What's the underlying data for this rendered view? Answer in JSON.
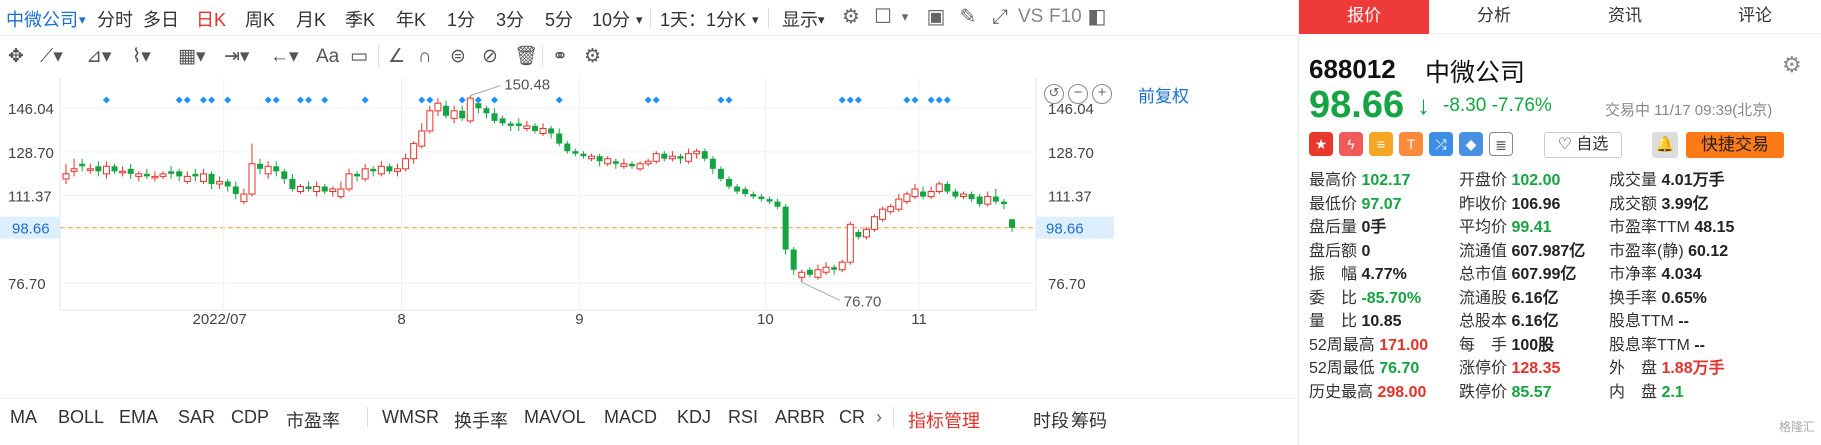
{
  "toolbar": {
    "symbol": "中微公司",
    "periods": [
      "分时",
      "多日",
      "日K",
      "周K",
      "月K",
      "季K",
      "年K",
      "1分",
      "3分",
      "5分",
      "10分"
    ],
    "active_period": "日K",
    "interval_select": "1天：1分K",
    "display_label": "显示",
    "vs_label": "VS",
    "f10_label": "F10"
  },
  "drawing_tools": [
    "crosshair",
    "line",
    "channel",
    "wave",
    "fibonacci",
    "measure",
    "arrow",
    "text",
    "note",
    "ruler",
    "magnet",
    "lock",
    "hide",
    "delete",
    "compare",
    "settings"
  ],
  "chart": {
    "fq_label": "前复权",
    "ctrl_minus": "−",
    "ctrl_plus": "+"
  },
  "chart_data": {
    "type": "candlestick",
    "title": "",
    "y_ticks": [
      "146.04",
      "128.70",
      "111.37",
      "98.66",
      "76.70"
    ],
    "x_ticks": [
      "2022/07",
      "8",
      "9",
      "10",
      "11"
    ],
    "ylim": [
      70,
      158
    ],
    "current_price": 98.66,
    "max_label": "150.48",
    "min_label": "76.70",
    "grid": true,
    "candles": [
      [
        1,
        118,
        120,
        116,
        124
      ],
      [
        1,
        121,
        122,
        119,
        126
      ],
      [
        0,
        124,
        123,
        121,
        126
      ],
      [
        1,
        122,
        122,
        120,
        124
      ],
      [
        0,
        121,
        123,
        119,
        125
      ],
      [
        1,
        120,
        123,
        118,
        125
      ],
      [
        0,
        123,
        121,
        120,
        124
      ],
      [
        1,
        121,
        121,
        119,
        123
      ],
      [
        0,
        122,
        120,
        118,
        124
      ],
      [
        1,
        119,
        120,
        117,
        121
      ],
      [
        0,
        120,
        119,
        118,
        122
      ],
      [
        1,
        119,
        119,
        117,
        121
      ],
      [
        1,
        119,
        120,
        118,
        121
      ],
      [
        0,
        120,
        121,
        118,
        123
      ],
      [
        0,
        121,
        119,
        117,
        122
      ],
      [
        1,
        117,
        119,
        116,
        121
      ],
      [
        0,
        119,
        120,
        117,
        122
      ],
      [
        1,
        117,
        120,
        116,
        122
      ],
      [
        0,
        120,
        116,
        114,
        121
      ],
      [
        1,
        116,
        117,
        114,
        119
      ],
      [
        0,
        117,
        115,
        113,
        118
      ],
      [
        0,
        115,
        112,
        110,
        117
      ],
      [
        1,
        109,
        112,
        108,
        114
      ],
      [
        1,
        112,
        124,
        111,
        132
      ],
      [
        0,
        124,
        122,
        120,
        126
      ],
      [
        1,
        120,
        123,
        118,
        125
      ],
      [
        0,
        123,
        121,
        119,
        125
      ],
      [
        0,
        121,
        118,
        116,
        122
      ],
      [
        0,
        118,
        114,
        113,
        120
      ],
      [
        1,
        113,
        115,
        112,
        116
      ],
      [
        0,
        115,
        114,
        113,
        117
      ],
      [
        1,
        113,
        115,
        111,
        117
      ],
      [
        0,
        115,
        113,
        112,
        116
      ],
      [
        1,
        113,
        114,
        111,
        115
      ],
      [
        1,
        111,
        114,
        110,
        117
      ],
      [
        1,
        114,
        120,
        113,
        122
      ],
      [
        0,
        120,
        119,
        117,
        121
      ],
      [
        1,
        118,
        122,
        117,
        124
      ],
      [
        0,
        122,
        121,
        119,
        123
      ],
      [
        1,
        120,
        123,
        119,
        125
      ],
      [
        0,
        123,
        121,
        120,
        124
      ],
      [
        1,
        121,
        122,
        119,
        124
      ],
      [
        1,
        122,
        126,
        121,
        128
      ],
      [
        1,
        126,
        132,
        124,
        133
      ],
      [
        1,
        131,
        137,
        130,
        140
      ],
      [
        1,
        137,
        145,
        136,
        147
      ],
      [
        1,
        145,
        148,
        143,
        150
      ],
      [
        0,
        147,
        143,
        142,
        149
      ],
      [
        1,
        142,
        145,
        140,
        147
      ],
      [
        0,
        145,
        142,
        141,
        147
      ],
      [
        1,
        141,
        150,
        140,
        151
      ],
      [
        0,
        148,
        146,
        144,
        149
      ],
      [
        0,
        146,
        144,
        142,
        147
      ],
      [
        0,
        144,
        141,
        140,
        146
      ],
      [
        0,
        142,
        140,
        139,
        143
      ],
      [
        0,
        140,
        139,
        137,
        141
      ],
      [
        0,
        140,
        139,
        137,
        142
      ],
      [
        1,
        138,
        139,
        137,
        141
      ],
      [
        0,
        139,
        137,
        136,
        140
      ],
      [
        1,
        136,
        138,
        135,
        140
      ],
      [
        0,
        138,
        136,
        134,
        139
      ],
      [
        0,
        136,
        132,
        131,
        138
      ],
      [
        0,
        132,
        129,
        128,
        133
      ],
      [
        0,
        129,
        128,
        127,
        130
      ],
      [
        0,
        128,
        127,
        126,
        129
      ],
      [
        1,
        126,
        127,
        125,
        128
      ],
      [
        0,
        127,
        125,
        123,
        128
      ],
      [
        1,
        124,
        126,
        123,
        127
      ],
      [
        0,
        125,
        124,
        122,
        126
      ],
      [
        1,
        123,
        124,
        122,
        126
      ],
      [
        0,
        124,
        123,
        122,
        125
      ],
      [
        1,
        122,
        124,
        121,
        125
      ],
      [
        1,
        124,
        125,
        123,
        126
      ],
      [
        1,
        125,
        128,
        124,
        129
      ],
      [
        0,
        128,
        126,
        125,
        129
      ],
      [
        1,
        126,
        127,
        125,
        129
      ],
      [
        0,
        127,
        126,
        124,
        128
      ],
      [
        1,
        125,
        128,
        124,
        130
      ],
      [
        1,
        128,
        129,
        126,
        130
      ],
      [
        0,
        129,
        126,
        125,
        130
      ],
      [
        0,
        126,
        122,
        120,
        127
      ],
      [
        0,
        122,
        118,
        117,
        123
      ],
      [
        0,
        118,
        115,
        114,
        119
      ],
      [
        0,
        115,
        113,
        112,
        116
      ],
      [
        0,
        114,
        112,
        111,
        115
      ],
      [
        0,
        112,
        111,
        110,
        113
      ],
      [
        0,
        111,
        110,
        109,
        112
      ],
      [
        0,
        110,
        109,
        108,
        111
      ],
      [
        0,
        109,
        107,
        106,
        110
      ],
      [
        0,
        107,
        90,
        88,
        108
      ],
      [
        0,
        90,
        82,
        80,
        91
      ],
      [
        1,
        79,
        81,
        77,
        82
      ],
      [
        0,
        82,
        80,
        79,
        83
      ],
      [
        1,
        79,
        82,
        78,
        84
      ],
      [
        1,
        81,
        83,
        80,
        85
      ],
      [
        0,
        83,
        82,
        80,
        84
      ],
      [
        1,
        82,
        85,
        81,
        86
      ],
      [
        1,
        85,
        100,
        84,
        101
      ],
      [
        0,
        97,
        95,
        94,
        98
      ],
      [
        1,
        95,
        98,
        94,
        99
      ],
      [
        1,
        98,
        103,
        97,
        104
      ],
      [
        1,
        102,
        106,
        101,
        107
      ],
      [
        1,
        105,
        107,
        104,
        108
      ],
      [
        1,
        106,
        110,
        105,
        112
      ],
      [
        1,
        109,
        112,
        108,
        113
      ],
      [
        1,
        111,
        114,
        110,
        116
      ],
      [
        0,
        113,
        111,
        110,
        115
      ],
      [
        1,
        111,
        113,
        110,
        115
      ],
      [
        1,
        113,
        116,
        112,
        117
      ],
      [
        0,
        116,
        113,
        112,
        117
      ],
      [
        0,
        113,
        111,
        110,
        114
      ],
      [
        1,
        111,
        112,
        110,
        113
      ],
      [
        0,
        112,
        110,
        109,
        113
      ],
      [
        0,
        111,
        108,
        107,
        112
      ],
      [
        1,
        108,
        111,
        107,
        113
      ],
      [
        0,
        111,
        109,
        108,
        114
      ],
      [
        0,
        109,
        108,
        106,
        110
      ],
      [
        0,
        102,
        98.66,
        97,
        102.17
      ]
    ],
    "markers": [
      5,
      14,
      15,
      17,
      18,
      20,
      25,
      26,
      29,
      30,
      32,
      37,
      44,
      45,
      49,
      51,
      53,
      61,
      72,
      73,
      81,
      82,
      96,
      97,
      98,
      104,
      105,
      107,
      108,
      109
    ]
  },
  "indicators": {
    "tabs": [
      "MA",
      "BOLL",
      "EMA",
      "SAR",
      "CDP",
      "市盈率",
      "WMSR",
      "换手率",
      "MAVOL",
      "MACD",
      "KDJ",
      "RSI",
      "ARBR",
      "CR"
    ],
    "more": "›",
    "manage": "指标管理",
    "right_tabs": [
      "时段",
      "筹码"
    ]
  },
  "panel": {
    "tabs": [
      "报价",
      "分析",
      "资讯",
      "评论"
    ],
    "active_tab": "报价",
    "code": "688012",
    "name": "中微公司",
    "price": "98.66",
    "change": "-8.30 -7.76%",
    "status": "交易中 11/17 09:39(北京)",
    "self_select": "自选",
    "quick_trade": "快捷交易",
    "quote_rows": [
      [
        {
          "label": "最高价",
          "value": "102.17",
          "tone": "dn"
        },
        {
          "label": "开盘价",
          "value": "102.00",
          "tone": "dn"
        },
        {
          "label": "成交量",
          "value": "4.01万手",
          "tone": "neu"
        }
      ],
      [
        {
          "label": "最低价",
          "value": "97.07",
          "tone": "dn"
        },
        {
          "label": "昨收价",
          "value": "106.96",
          "tone": "neu"
        },
        {
          "label": "成交额",
          "value": "3.99亿",
          "tone": "neu"
        }
      ],
      [
        {
          "label": "盘后量",
          "value": "0手",
          "tone": "neu"
        },
        {
          "label": "平均价",
          "value": "99.41",
          "tone": "dn"
        },
        {
          "label": "市盈率TTM",
          "value": "48.15",
          "tone": "neu"
        }
      ],
      [
        {
          "label": "盘后额",
          "value": "0",
          "tone": "neu"
        },
        {
          "label": "流通值",
          "value": "607.987亿",
          "tone": "neu"
        },
        {
          "label": "市盈率(静)",
          "value": "60.12",
          "tone": "neu"
        }
      ],
      [
        {
          "label": "振　幅",
          "value": "4.77%",
          "tone": "neu"
        },
        {
          "label": "总市值",
          "value": "607.99亿",
          "tone": "neu"
        },
        {
          "label": "市净率",
          "value": "4.034",
          "tone": "neu"
        }
      ],
      [
        {
          "label": "委　比",
          "value": "-85.70%",
          "tone": "dn"
        },
        {
          "label": "流通股",
          "value": "6.16亿",
          "tone": "neu"
        },
        {
          "label": "换手率",
          "value": "0.65%",
          "tone": "neu"
        }
      ],
      [
        {
          "label": "量　比",
          "value": "10.85",
          "tone": "neu"
        },
        {
          "label": "总股本",
          "value": "6.16亿",
          "tone": "neu"
        },
        {
          "label": "股息TTM",
          "value": "--",
          "tone": "neu"
        }
      ],
      [
        {
          "label": "52周最高",
          "value": "171.00",
          "tone": "up"
        },
        {
          "label": "每　手",
          "value": "100股",
          "tone": "neu"
        },
        {
          "label": "股息率TTM",
          "value": "--",
          "tone": "neu"
        }
      ],
      [
        {
          "label": "52周最低",
          "value": "76.70",
          "tone": "dn"
        },
        {
          "label": "涨停价",
          "value": "128.35",
          "tone": "up"
        },
        {
          "label": "外　盘",
          "value": "1.88万手",
          "tone": "up"
        }
      ],
      [
        {
          "label": "历史最高",
          "value": "298.00",
          "tone": "up"
        },
        {
          "label": "跌停价",
          "value": "85.57",
          "tone": "dn"
        },
        {
          "label": "内　盘",
          "value": "2.1",
          "tone": "dn"
        }
      ]
    ],
    "watermark": "格隆汇"
  },
  "colors": {
    "up": "#e3322b",
    "down": "#15a442",
    "accent": "#1a6fd3",
    "marker": "#1e90ff",
    "price_line": "#f0a040"
  }
}
